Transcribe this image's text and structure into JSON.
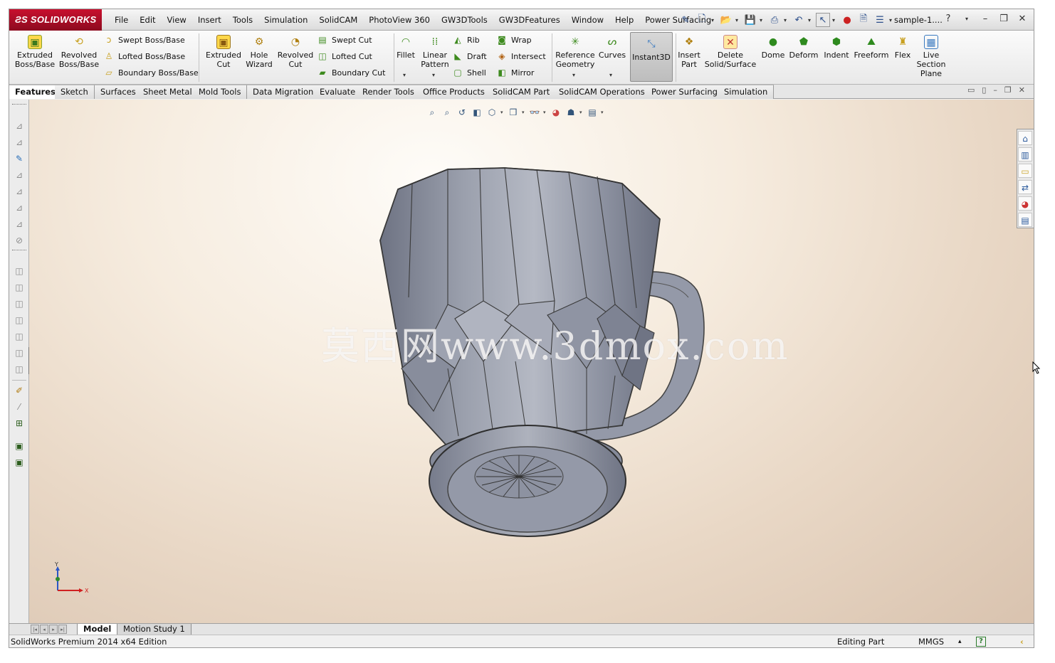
{
  "app": {
    "logo": "SOLIDWORKS",
    "doc_title": "sample-1...."
  },
  "menu": [
    "File",
    "Edit",
    "View",
    "Insert",
    "Tools",
    "Simulation",
    "SolidCAM",
    "PhotoView 360",
    "GW3DTools",
    "GW3DFeatures",
    "Window",
    "Help",
    "Power Surfacing"
  ],
  "commands": {
    "extruded_boss": "Extruded\nBoss/Base",
    "revolved_boss": "Revolved\nBoss/Base",
    "swept_boss": "Swept Boss/Base",
    "lofted_boss": "Lofted Boss/Base",
    "boundary_boss": "Boundary Boss/Base",
    "extruded_cut": "Extruded\nCut",
    "hole_wizard": "Hole\nWizard",
    "revolved_cut": "Revolved\nCut",
    "swept_cut": "Swept Cut",
    "lofted_cut": "Lofted Cut",
    "boundary_cut": "Boundary Cut",
    "fillet": "Fillet",
    "linear_pattern": "Linear\nPattern",
    "rib": "Rib",
    "draft": "Draft",
    "shell": "Shell",
    "wrap": "Wrap",
    "intersect": "Intersect",
    "mirror": "Mirror",
    "reference_geometry": "Reference\nGeometry",
    "curves": "Curves",
    "instant3d": "Instant3D",
    "insert_part": "Insert\nPart",
    "delete_solid": "Delete\nSolid/Surface",
    "dome": "Dome",
    "deform": "Deform",
    "indent": "Indent",
    "freeform": "Freeform",
    "flex": "Flex",
    "live_section": "Live\nSection\nPlane"
  },
  "tabs": [
    "Features",
    "Sketch",
    "Surfaces",
    "Sheet Metal",
    "Mold Tools",
    "Data Migration",
    "Evaluate",
    "Render Tools",
    "Office Products",
    "SolidCAM Part",
    "SolidCAM Operations",
    "Power Surfacing",
    "Simulation"
  ],
  "watermark": "莫西网www.3dmox.com",
  "triad": {
    "x": "X",
    "y": "Y"
  },
  "model_tabs": [
    "Model",
    "Motion Study 1"
  ],
  "status": {
    "left": "SolidWorks Premium 2014 x64 Edition",
    "mode": "Editing Part",
    "units": "MMGS",
    "units_arrow": "▴",
    "help": "?",
    "arrow": "‹"
  },
  "colors": {
    "brand": "#c8102e",
    "viewport_top": "#fefcf8",
    "viewport_bottom": "#d9c3af",
    "model": "#8e93a2"
  }
}
